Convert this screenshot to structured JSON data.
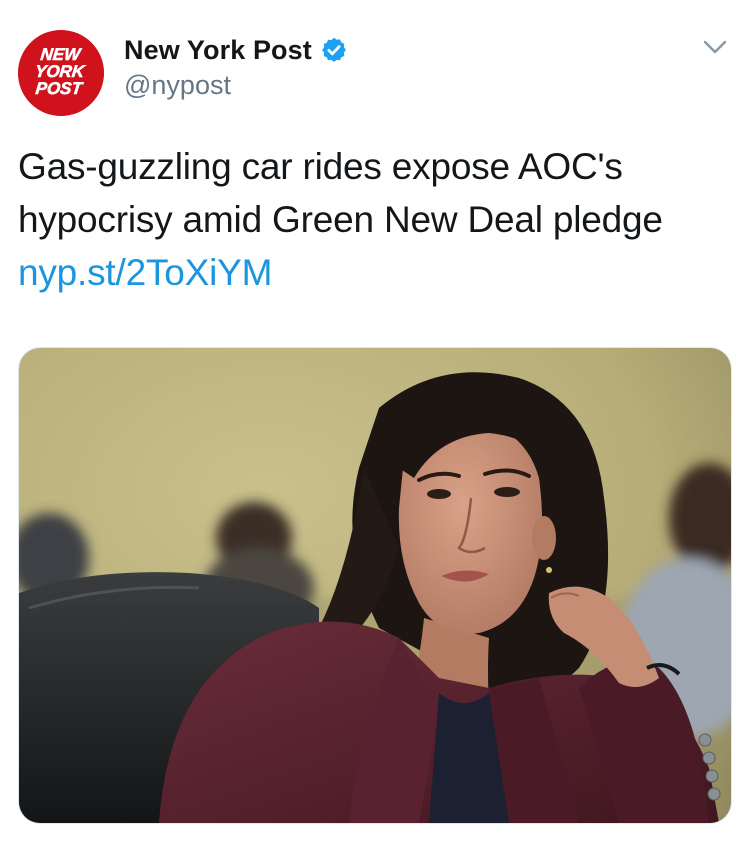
{
  "account": {
    "display_name": "New York Post",
    "handle": "@nypost",
    "verified": true,
    "avatar_logo_text": [
      "NEW",
      "YORK",
      "POST"
    ],
    "avatar_color": "#d0121d"
  },
  "tweet": {
    "text": "Gas-guzzling car rides expose AOC's hypocrisy amid Green New Deal pledge ",
    "link_text": "nyp.st/2ToXiYM",
    "link_color": "#1b95e0"
  },
  "icons": {
    "verified": "verified-badge-icon",
    "menu": "chevron-down-icon"
  },
  "media": {
    "kind": "photo",
    "subject": "woman in burgundy blazer seated in a black leather chair, hand at ear, looking up"
  },
  "colors": {
    "text": "#14171a",
    "secondary": "#657786",
    "verified": "#1da1f2"
  }
}
